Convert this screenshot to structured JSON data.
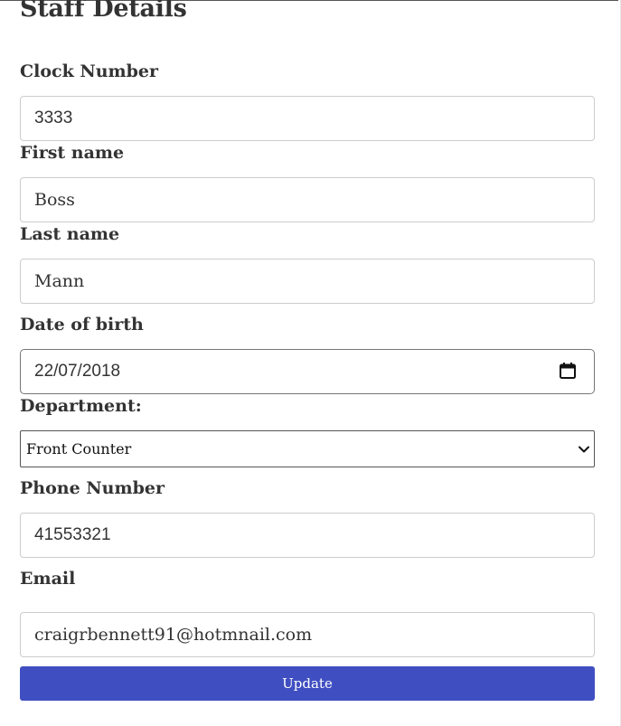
{
  "page": {
    "title": "Staff Details"
  },
  "form": {
    "clock_number": {
      "label": "Clock Number",
      "value": "3333"
    },
    "first_name": {
      "label": "First name",
      "value": "Boss"
    },
    "last_name": {
      "label": "Last name",
      "value": "Mann"
    },
    "date_of_birth": {
      "label": "Date of birth",
      "value": "22/07/2018",
      "icon": "calendar-icon"
    },
    "department": {
      "label": "Department:",
      "selected": "Front Counter",
      "icon": "chevron-down-icon"
    },
    "phone_number": {
      "label": "Phone Number",
      "value": "41553321"
    },
    "email": {
      "label": "Email",
      "value": "craigrbennett91@hotmnail.com"
    },
    "submit_label": "Update"
  },
  "colors": {
    "button_bg": "#3f4fc1",
    "button_text": "#ffffff",
    "text": "#333333",
    "input_border": "#cccccc"
  }
}
